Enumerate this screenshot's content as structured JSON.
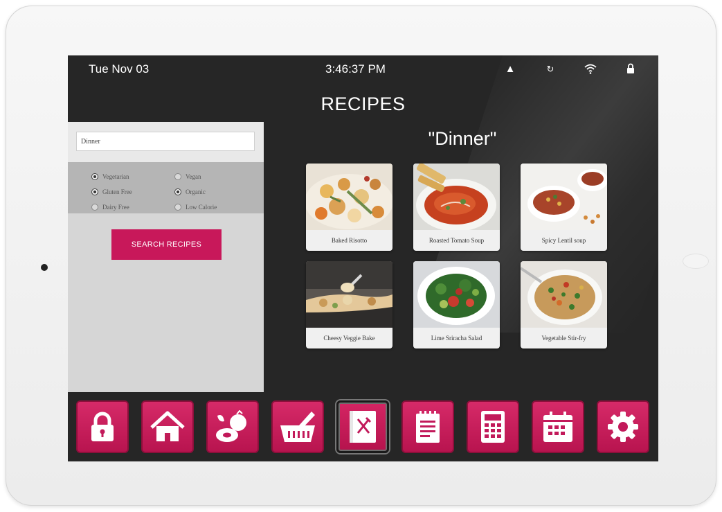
{
  "status_bar": {
    "date": "Tue Nov 03",
    "time": "3:46:37 PM",
    "icons": [
      "warning-icon",
      "sync-icon",
      "wifi-icon",
      "lock-icon"
    ]
  },
  "page_title": "RECIPES",
  "search": {
    "input_value": "Dinner",
    "filters": [
      {
        "label": "Vegetarian",
        "checked": true
      },
      {
        "label": "Vegan",
        "checked": false
      },
      {
        "label": "Gluten Free",
        "checked": true
      },
      {
        "label": "Organic",
        "checked": true
      },
      {
        "label": "Dairy Free",
        "checked": false
      },
      {
        "label": "Low Calorie",
        "checked": false
      }
    ],
    "button_label": "SEARCH RECIPES"
  },
  "results": {
    "query_title": "\"Dinner\"",
    "recipes": [
      {
        "name": "Baked Risotto"
      },
      {
        "name": "Roasted Tomato Soup"
      },
      {
        "name": "Spicy Lentil soup"
      },
      {
        "name": "Cheesy Veggie Bake"
      },
      {
        "name": "Lime Sriracha Salad"
      },
      {
        "name": "Vegetable Stir-fry"
      }
    ]
  },
  "nav": {
    "items": [
      {
        "icon": "padlock-icon"
      },
      {
        "icon": "home-icon"
      },
      {
        "icon": "groceries-icon"
      },
      {
        "icon": "shopping-basket-icon"
      },
      {
        "icon": "recipe-book-icon",
        "active": true
      },
      {
        "icon": "notepad-icon"
      },
      {
        "icon": "calculator-icon"
      },
      {
        "icon": "calendar-icon"
      },
      {
        "icon": "settings-gear-icon"
      }
    ]
  },
  "colors": {
    "accent": "#c8185a",
    "screen_background": "#262626",
    "panel_background": "#d6d6d6"
  }
}
